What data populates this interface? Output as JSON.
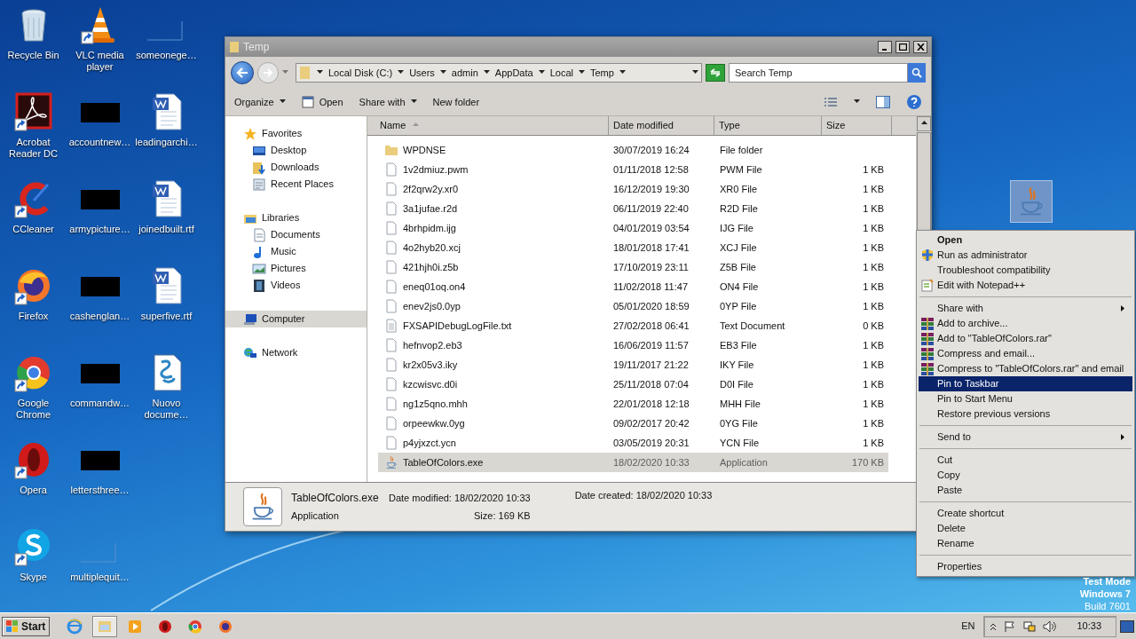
{
  "desktop_icons": [
    {
      "label": "Recycle Bin",
      "kind": "recycle",
      "shortcut": false
    },
    {
      "label": "Acrobat Reader DC",
      "kind": "acrobat",
      "shortcut": true
    },
    {
      "label": "CCleaner",
      "kind": "ccleaner",
      "shortcut": true
    },
    {
      "label": "Firefox",
      "kind": "firefox",
      "shortcut": true
    },
    {
      "label": "Google Chrome",
      "kind": "chrome",
      "shortcut": true
    },
    {
      "label": "Opera",
      "kind": "opera",
      "shortcut": true
    },
    {
      "label": "Skype",
      "kind": "skype",
      "shortcut": true
    },
    {
      "label": "VLC media player",
      "kind": "vlc",
      "shortcut": true
    },
    {
      "label": "accountnew…",
      "kind": "redacted",
      "shortcut": false
    },
    {
      "label": "armypicture…",
      "kind": "redacted",
      "shortcut": false
    },
    {
      "label": "cashenglan…",
      "kind": "redacted",
      "shortcut": false
    },
    {
      "label": "commandw…",
      "kind": "redacted",
      "shortcut": false
    },
    {
      "label": "lettersthree…",
      "kind": "redacted",
      "shortcut": false
    },
    {
      "label": "multiplequit…",
      "kind": "blank",
      "shortcut": false
    },
    {
      "label": "someonege…",
      "kind": "blank",
      "shortcut": false
    },
    {
      "label": "leadingarchi…",
      "kind": "word",
      "shortcut": false
    },
    {
      "label": "joinedbuilt.rtf",
      "kind": "word",
      "shortcut": false
    },
    {
      "label": "superfive.rtf",
      "kind": "word",
      "shortcut": false
    },
    {
      "label": "Nuovo docume…",
      "kind": "script",
      "shortcut": false
    }
  ],
  "explorer": {
    "title": "Temp",
    "breadcrumbs": [
      "Local Disk (C:)",
      "Users",
      "admin",
      "AppData",
      "Local",
      "Temp"
    ],
    "search": {
      "placeholder": "Search Temp"
    },
    "toolbar": [
      {
        "label": "Organize",
        "kind": "menu"
      },
      {
        "label": "Open",
        "kind": "open"
      },
      {
        "label": "Share with",
        "kind": "menu"
      },
      {
        "label": "New folder",
        "kind": "plain"
      }
    ],
    "nav": [
      {
        "label": "Favorites",
        "kind": "star",
        "selected": false,
        "children": [
          {
            "label": "Desktop",
            "kind": "desktop",
            "selected": false
          },
          {
            "label": "Downloads",
            "kind": "downloads",
            "selected": false
          },
          {
            "label": "Recent Places",
            "kind": "recent",
            "selected": false
          }
        ]
      },
      {
        "label": "Libraries",
        "kind": "libraries",
        "selected": false,
        "children": [
          {
            "label": "Documents",
            "kind": "documents",
            "selected": false
          },
          {
            "label": "Music",
            "kind": "music",
            "selected": false
          },
          {
            "label": "Pictures",
            "kind": "pictures",
            "selected": false
          },
          {
            "label": "Videos",
            "kind": "videos",
            "selected": false
          }
        ]
      },
      {
        "label": "Computer",
        "kind": "computer",
        "selected": true
      },
      {
        "label": "Network",
        "kind": "network",
        "selected": false
      }
    ],
    "columns": [
      {
        "label": "Name",
        "sorted": true
      },
      {
        "label": "Date modified",
        "sorted": false
      },
      {
        "label": "Type",
        "sorted": false
      },
      {
        "label": "Size",
        "sorted": false
      }
    ],
    "rows": [
      {
        "name": "WPDNSE",
        "date": "30/07/2019 16:24",
        "type": "File folder",
        "kind": "folder",
        "selected": false
      },
      {
        "name": "1v2dmiuz.pwm",
        "date": "01/11/2018 12:58",
        "type": "PWM File",
        "size": "1 KB",
        "kind": "file",
        "selected": false
      },
      {
        "name": "2f2qrw2y.xr0",
        "date": "16/12/2019 19:30",
        "type": "XR0 File",
        "size": "1 KB",
        "kind": "file",
        "selected": false
      },
      {
        "name": "3a1jufae.r2d",
        "date": "06/11/2019 22:40",
        "type": "R2D File",
        "size": "1 KB",
        "kind": "file",
        "selected": false
      },
      {
        "name": "4brhpidm.ijg",
        "date": "04/01/2019 03:54",
        "type": "IJG File",
        "size": "1 KB",
        "kind": "file",
        "selected": false
      },
      {
        "name": "4o2hyb20.xcj",
        "date": "18/01/2018 17:41",
        "type": "XCJ File",
        "size": "1 KB",
        "kind": "file",
        "selected": false
      },
      {
        "name": "421hjh0i.z5b",
        "date": "17/10/2019 23:11",
        "type": "Z5B File",
        "size": "1 KB",
        "kind": "file",
        "selected": false
      },
      {
        "name": "eneq01oq.on4",
        "date": "11/02/2018 11:47",
        "type": "ON4 File",
        "size": "1 KB",
        "kind": "file",
        "selected": false
      },
      {
        "name": "enev2js0.0yp",
        "date": "05/01/2020 18:59",
        "type": "0YP File",
        "size": "1 KB",
        "kind": "file",
        "selected": false
      },
      {
        "name": "FXSAPIDebugLogFile.txt",
        "date": "27/02/2018 06:41",
        "type": "Text Document",
        "size": "0 KB",
        "kind": "text",
        "selected": false
      },
      {
        "name": "hefnvop2.eb3",
        "date": "16/06/2019 11:57",
        "type": "EB3 File",
        "size": "1 KB",
        "kind": "file",
        "selected": false
      },
      {
        "name": "kr2x05v3.iky",
        "date": "19/11/2017 21:22",
        "type": "IKY File",
        "size": "1 KB",
        "kind": "file",
        "selected": false
      },
      {
        "name": "kzcwisvc.d0i",
        "date": "25/11/2018 07:04",
        "type": "D0I File",
        "size": "1 KB",
        "kind": "file",
        "selected": false
      },
      {
        "name": "ng1z5qno.mhh",
        "date": "22/01/2018 12:18",
        "type": "MHH File",
        "size": "1 KB",
        "kind": "file",
        "selected": false
      },
      {
        "name": "orpeewkw.0yg",
        "date": "09/02/2017 20:42",
        "type": "0YG File",
        "size": "1 KB",
        "kind": "file",
        "selected": false
      },
      {
        "name": "p4yjxzct.ycn",
        "date": "03/05/2019 20:31",
        "type": "YCN File",
        "size": "1 KB",
        "kind": "file",
        "selected": false
      },
      {
        "name": "TableOfColors.exe",
        "date": "18/02/2020 10:33",
        "type": "Application",
        "size": "170 KB",
        "kind": "app",
        "selected": true
      }
    ],
    "details": {
      "name": "TableOfColors.exe",
      "type": "Application",
      "modified": "Date modified: 18/02/2020 10:33",
      "size": "Size: 169 KB",
      "created": "Date created: 18/02/2020 10:33"
    }
  },
  "context_menu": [
    {
      "kind": "default",
      "label": "Open",
      "selected": false
    },
    {
      "kind": "admin",
      "label": "Run as administrator",
      "selected": false
    },
    {
      "kind": "plain",
      "label": "Troubleshoot compatibility",
      "selected": false
    },
    {
      "kind": "notepad",
      "label": "Edit with Notepad++",
      "selected": false
    },
    {
      "kind": "separator"
    },
    {
      "kind": "submenu",
      "label": "Share with",
      "selected": false
    },
    {
      "kind": "archive",
      "label": "Add to archive...",
      "selected": false
    },
    {
      "kind": "archive",
      "label": "Add to \"TableOfColors.rar\"",
      "selected": false
    },
    {
      "kind": "archive",
      "label": "Compress and email...",
      "selected": false
    },
    {
      "kind": "archive",
      "label": "Compress to \"TableOfColors.rar\" and email",
      "selected": false
    },
    {
      "kind": "plain",
      "label": "Pin to Taskbar",
      "selected": true
    },
    {
      "kind": "plain",
      "label": "Pin to Start Menu",
      "selected": false
    },
    {
      "kind": "plain",
      "label": "Restore previous versions",
      "selected": false
    },
    {
      "kind": "separator"
    },
    {
      "kind": "submenu",
      "label": "Send to",
      "selected": false
    },
    {
      "kind": "separator"
    },
    {
      "kind": "plain",
      "label": "Cut",
      "selected": false
    },
    {
      "kind": "plain",
      "label": "Copy",
      "selected": false
    },
    {
      "kind": "plain",
      "label": "Paste",
      "selected": false
    },
    {
      "kind": "separator"
    },
    {
      "kind": "plain",
      "label": "Create shortcut",
      "selected": false
    },
    {
      "kind": "plain",
      "label": "Delete",
      "selected": false
    },
    {
      "kind": "plain",
      "label": "Rename",
      "selected": false
    },
    {
      "kind": "separator"
    },
    {
      "kind": "plain",
      "label": "Properties",
      "selected": false
    }
  ],
  "os_notice": [
    "Test Mode",
    "Windows 7",
    "Build 7601"
  ],
  "taskbar": {
    "start": "Start",
    "apps": [
      {
        "kind": "ie",
        "active": false
      },
      {
        "kind": "explorer",
        "active": true
      },
      {
        "kind": "media",
        "active": false
      },
      {
        "kind": "opera",
        "active": false
      },
      {
        "kind": "chrome",
        "active": false
      },
      {
        "kind": "firefox",
        "active": false
      }
    ],
    "language": "EN",
    "time": "10:33"
  }
}
